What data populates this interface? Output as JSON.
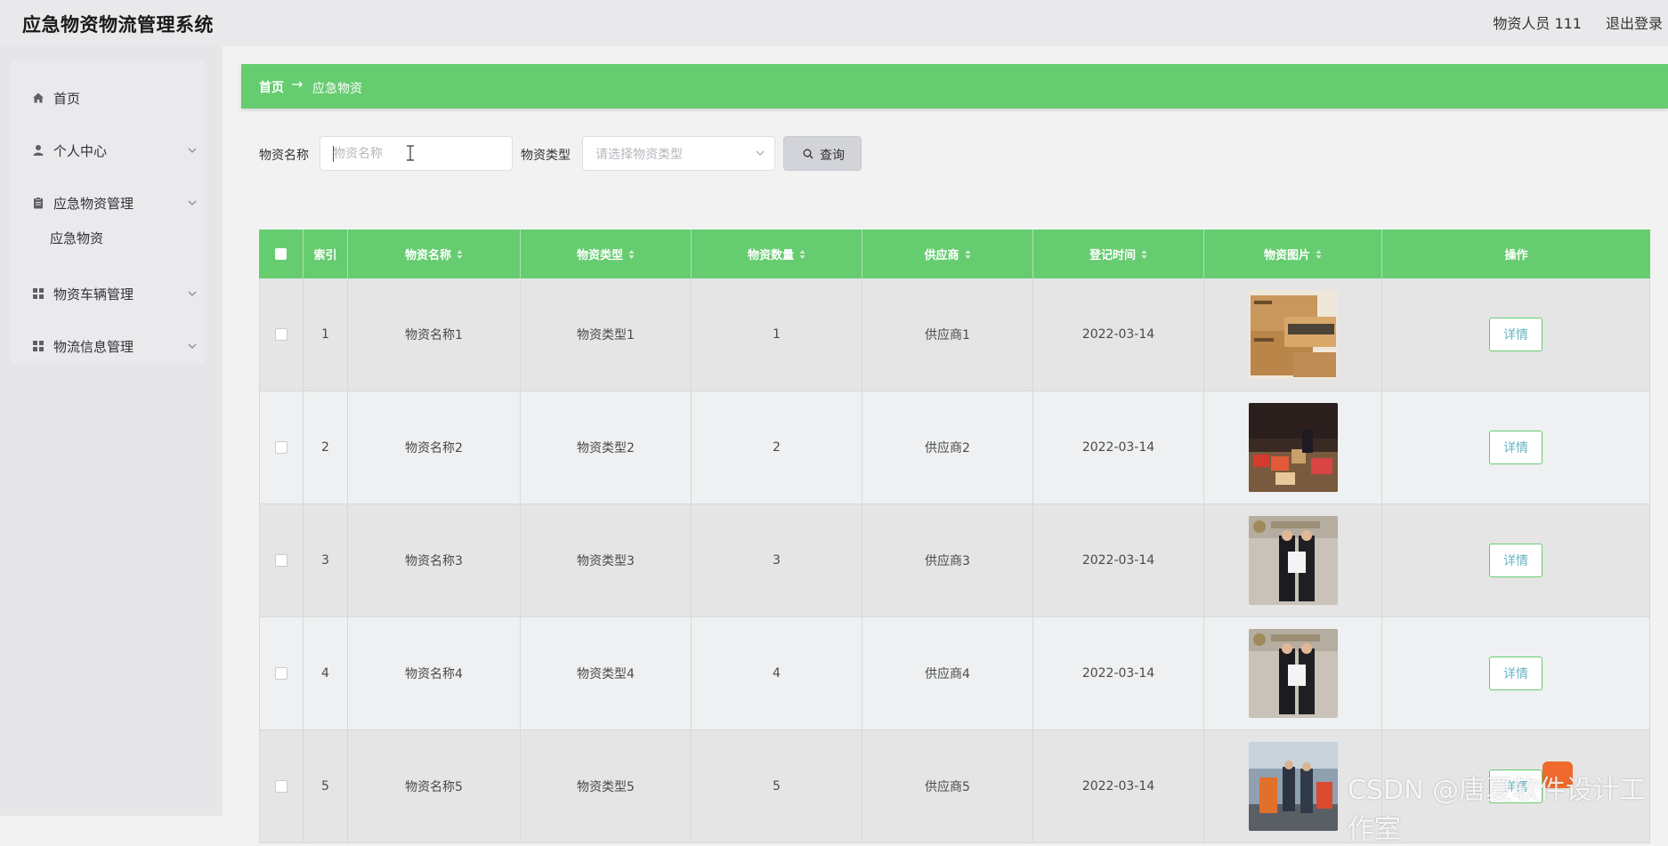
{
  "app": {
    "title": "应急物资物流管理系统",
    "user": "物资人员 111",
    "logout": "退出登录"
  },
  "sidebar": {
    "items": [
      {
        "label": "首页",
        "icon": "home-icon"
      },
      {
        "label": "个人中心",
        "icon": "user-icon"
      },
      {
        "label": "应急物资管理",
        "icon": "clipboard-icon"
      },
      {
        "label": "物资车辆管理",
        "icon": "grid-icon"
      },
      {
        "label": "物流信息管理",
        "icon": "grid-icon"
      }
    ],
    "submenu": {
      "label": "应急物资"
    }
  },
  "breadcrumb": {
    "home": "首页",
    "separator": "→",
    "current": "应急物资"
  },
  "search": {
    "name_label": "物资名称",
    "name_placeholder": "物资名称",
    "type_label": "物资类型",
    "type_placeholder": "请选择物资类型",
    "button": "查询"
  },
  "table": {
    "headers": {
      "index": "索引",
      "name": "物资名称",
      "type": "物资类型",
      "quantity": "物资数量",
      "supplier": "供应商",
      "date": "登记时间",
      "image": "物资图片",
      "action": "操作"
    },
    "rows": [
      {
        "index": "1",
        "name": "物资名称1",
        "type": "物资类型1",
        "quantity": "1",
        "supplier": "供应商1",
        "date": "2022-03-14",
        "action": "详情"
      },
      {
        "index": "2",
        "name": "物资名称2",
        "type": "物资类型2",
        "quantity": "2",
        "supplier": "供应商2",
        "date": "2022-03-14",
        "action": "详情"
      },
      {
        "index": "3",
        "name": "物资名称3",
        "type": "物资类型3",
        "quantity": "3",
        "supplier": "供应商3",
        "date": "2022-03-14",
        "action": "详情"
      },
      {
        "index": "4",
        "name": "物资名称4",
        "type": "物资类型4",
        "quantity": "4",
        "supplier": "供应商4",
        "date": "2022-03-14",
        "action": "详情"
      },
      {
        "index": "5",
        "name": "物资名称5",
        "type": "物资类型5",
        "quantity": "5",
        "supplier": "供应商5",
        "date": "2022-03-14",
        "action": "详情"
      }
    ]
  },
  "watermark": "CSDN @唐夏软件设计工作室",
  "colors": {
    "accent": "#66cc70",
    "detail_text": "#66b5c4",
    "row_odd": "#e5e5e6",
    "row_even": "#eef0f1"
  }
}
